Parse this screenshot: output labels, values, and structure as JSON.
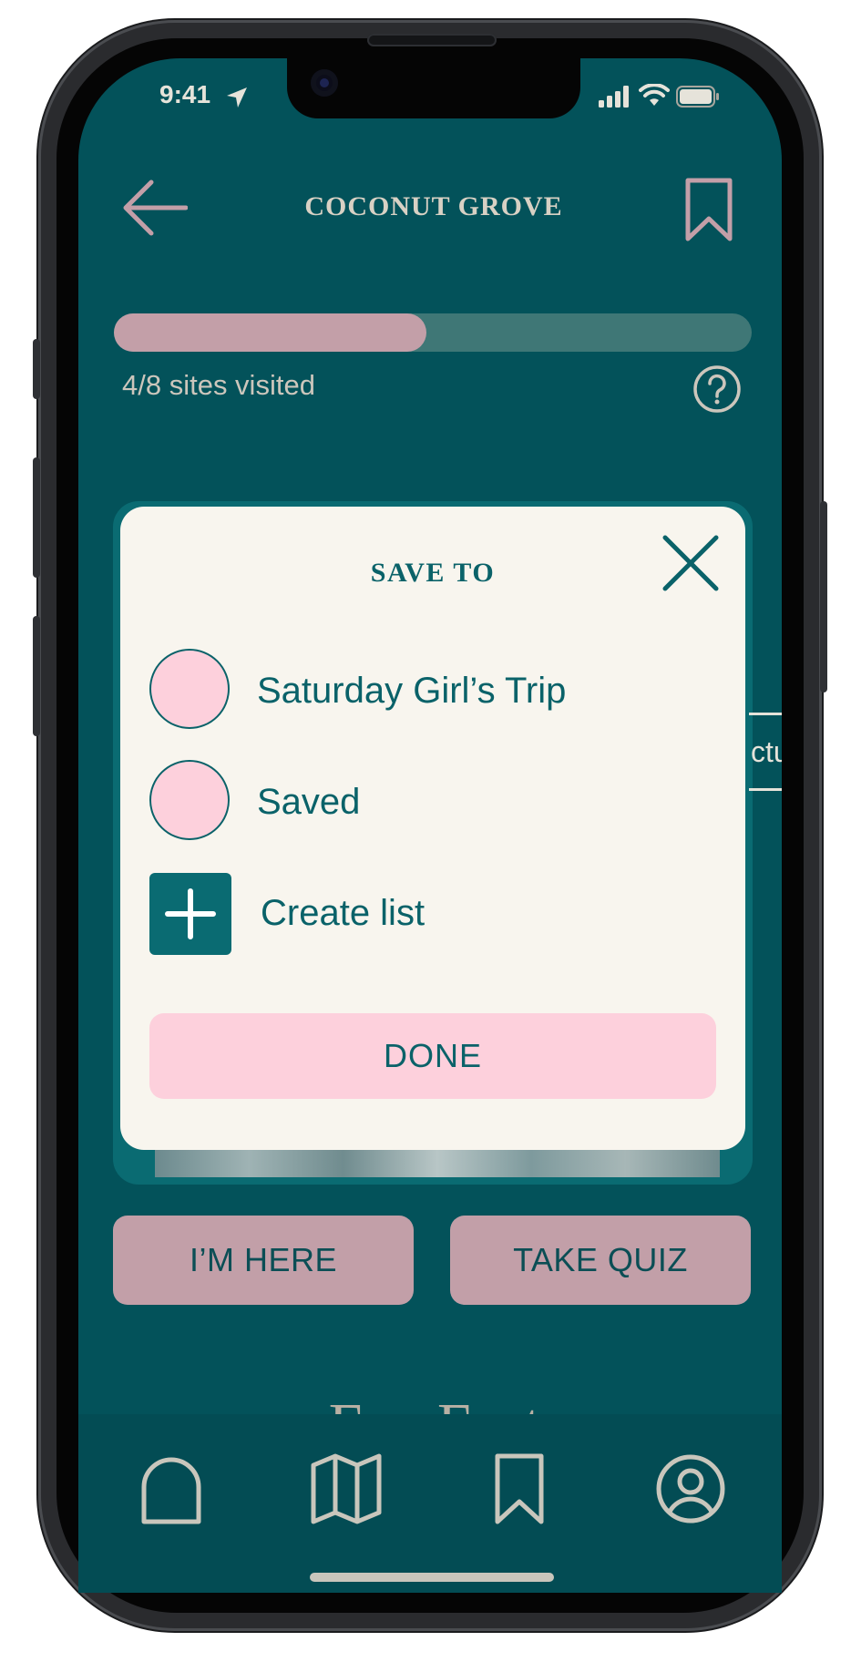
{
  "status_bar": {
    "time": "9:41"
  },
  "header": {
    "title": "COCONUT GROVE"
  },
  "progress": {
    "visited": 4,
    "total": 8,
    "fraction": 0.5,
    "label": "4/8 sites visited"
  },
  "modal": {
    "title": "SAVE TO",
    "lists": [
      {
        "label": "Saturday Girl’s Trip"
      },
      {
        "label": "Saved"
      }
    ],
    "create_label": "Create list",
    "done_label": "DONE"
  },
  "background_peek": {
    "text": "ctu"
  },
  "actions": {
    "here_label": "I’M HERE",
    "quiz_label": "TAKE QUIZ"
  },
  "section_peek": {
    "text": "Fun Facts"
  },
  "tabbar": {
    "items": [
      {
        "icon": "home-arch-icon"
      },
      {
        "icon": "map-icon"
      },
      {
        "icon": "bookmark-icon"
      },
      {
        "icon": "profile-icon"
      }
    ]
  },
  "colors": {
    "background": "#03525a",
    "accent_pink": "#fdd0dc",
    "muted_pink": "#c29fa8",
    "modal_bg": "#f8f5ee",
    "teal_text": "#0a6269"
  }
}
